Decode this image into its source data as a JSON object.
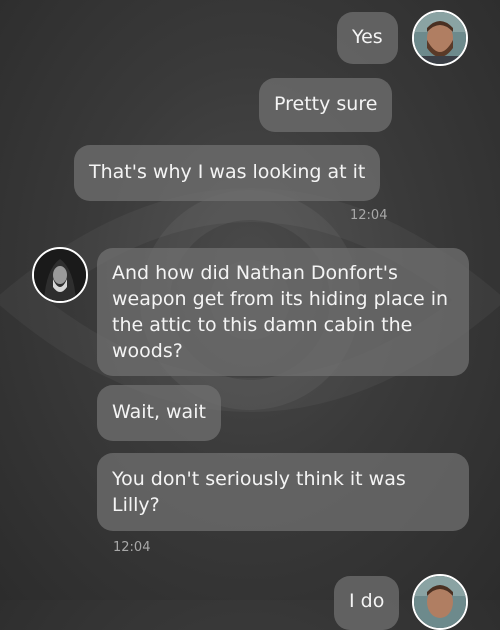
{
  "messages": [
    {
      "sender": "me",
      "text": "Yes"
    },
    {
      "sender": "me",
      "text": "Pretty sure"
    },
    {
      "sender": "me",
      "text": "That's why I was looking at it"
    },
    {
      "sender": "them",
      "text": "And how did Nathan Donfort's weapon get from its hiding place in the attic to this damn cabin the woods?"
    },
    {
      "sender": "them",
      "text": "Wait, wait"
    },
    {
      "sender": "them",
      "text": "You don't seriously think it was Lilly?"
    },
    {
      "sender": "me",
      "text": "I do"
    }
  ],
  "timestamps": [
    "12:04",
    "12:04"
  ]
}
